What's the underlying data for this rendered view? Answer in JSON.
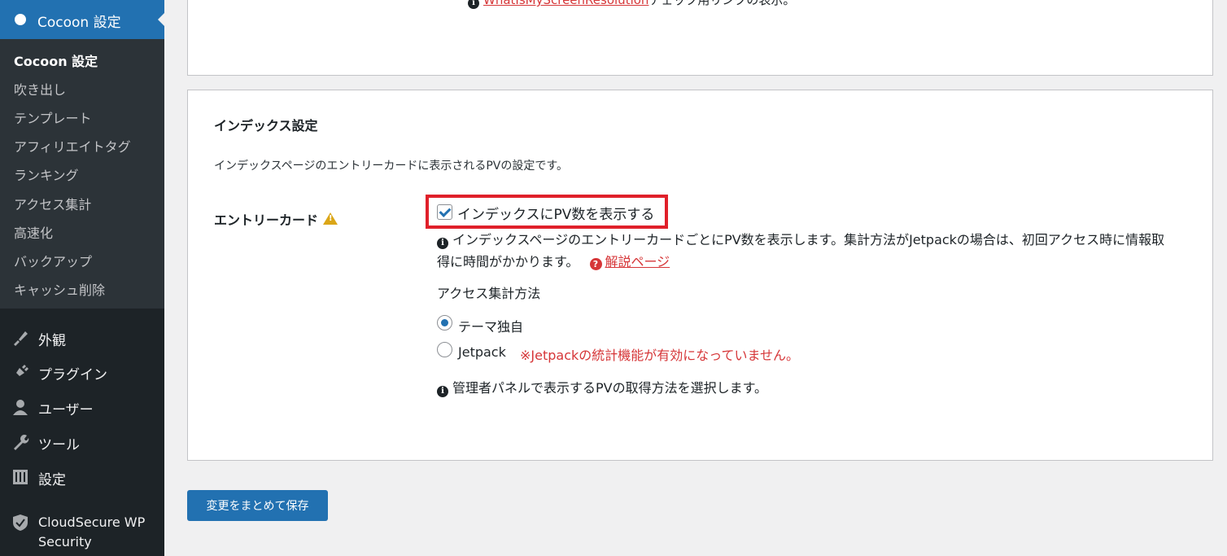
{
  "sidebar": {
    "active_menu": "Cocoon 設定",
    "submenu": [
      "Cocoon 設定",
      "吹き出し",
      "テンプレート",
      "アフィリエイトタグ",
      "ランキング",
      "アクセス集計",
      "高速化",
      "バックアップ",
      "キャッシュ削除"
    ],
    "menu": [
      {
        "label": "外観",
        "icon": "brush-icon"
      },
      {
        "label": "プラグイン",
        "icon": "plugin-icon"
      },
      {
        "label": "ユーザー",
        "icon": "user-icon"
      },
      {
        "label": "ツール",
        "icon": "wrench-icon"
      },
      {
        "label": "設定",
        "icon": "settings-icon"
      }
    ],
    "security_plugin": "CloudSecure WP Security"
  },
  "top_panel": {
    "link_text": "WhatIsMyScreenResolution",
    "suffix": "チェック用リンクの表示。"
  },
  "index_settings": {
    "title": "インデックス設定",
    "description": "インデックスページのエントリーカードに表示されるPVの設定です。",
    "row_label": "エントリーカード",
    "checkbox_label": "インデックスにPV数を表示する",
    "checkbox_checked": true,
    "help_text": "インデックスページのエントリーカードごとにPV数を表示します。集計方法がJetpackの場合は、初回アクセス時に情報取得に時間がかかります。",
    "help_link": "解説ページ",
    "method_heading": "アクセス集計方法",
    "radio_options": [
      "テーマ独自",
      "Jetpack"
    ],
    "selected_option": "テーマ独自",
    "jetpack_warning": "※Jetpackの統計機能が有効になっていません。",
    "method_note": "管理者パネルで表示するPVの取得方法を選択します。"
  },
  "save_button": "変更をまとめて保存",
  "colors": {
    "accent": "#2271b1",
    "warning": "#d63638",
    "highlight": "#e0202a"
  }
}
